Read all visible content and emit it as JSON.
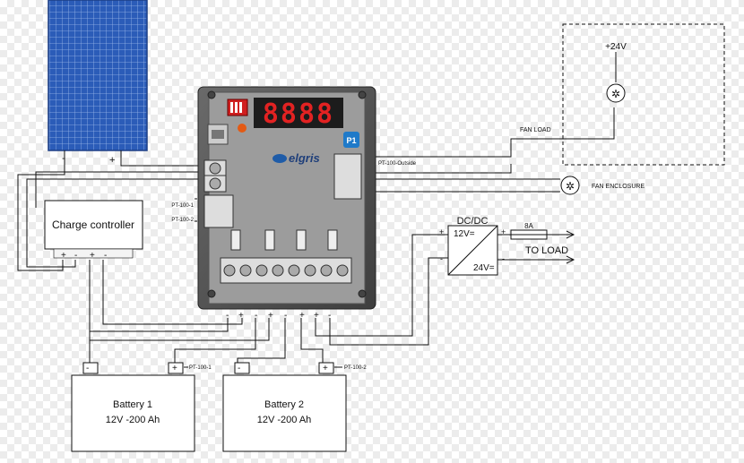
{
  "controller": {
    "brand": "elgris",
    "display_digits": "8888",
    "badge": "P1",
    "inputs": [
      "PT-100-1",
      "PT-100-2"
    ],
    "output_label": "PT-100-Outside"
  },
  "solar_panel": {
    "terminals": [
      "-",
      "+"
    ]
  },
  "charge_controller": {
    "label": "Charge controller",
    "terminals": [
      "+",
      "-",
      "+",
      "-"
    ]
  },
  "controller_bottom_terminals": [
    "-",
    "+",
    "-",
    "+",
    "-",
    "+",
    "+",
    "-"
  ],
  "dcdc": {
    "title": "DC/DC",
    "in_label": "12V=",
    "out_label": "24V=",
    "in_terms": [
      "+",
      "-"
    ],
    "out_terms": [
      "+",
      "-"
    ]
  },
  "fuse": {
    "label": "8A"
  },
  "load": {
    "label": "TO LOAD"
  },
  "fan_load": {
    "label": "FAN LOAD",
    "voltage": "+24V"
  },
  "fan_enclosure": {
    "label": "FAN ENCLOSURE"
  },
  "batteries": [
    {
      "name": "Battery 1",
      "spec": "12V -200 Ah",
      "sensor": "PT-100-1",
      "terminals": [
        "-",
        "+"
      ]
    },
    {
      "name": "Battery 2",
      "spec": "12V -200 Ah",
      "sensor": "PT-100-2",
      "terminals": [
        "-",
        "+"
      ]
    }
  ]
}
